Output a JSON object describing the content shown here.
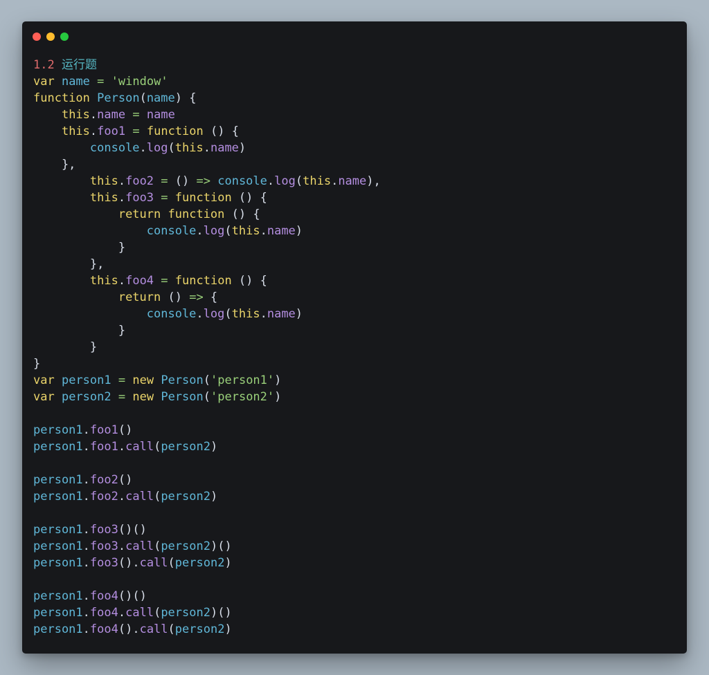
{
  "window": {
    "controls": [
      "close",
      "minimize",
      "maximize"
    ]
  },
  "colors": {
    "background": "#abb8c3",
    "panel": "#17181b",
    "keyword": "#ead46a",
    "identifier": "#60b7d8",
    "string": "#9ad07a",
    "property": "#b48ee0",
    "number": "#e06c6c",
    "punctuation": "#d8dee9"
  },
  "code": {
    "lines": [
      [
        [
          "num",
          "1.2"
        ],
        [
          "p",
          " "
        ],
        [
          "cjk",
          "运行题"
        ]
      ],
      [
        [
          "kw",
          "var"
        ],
        [
          "p",
          " "
        ],
        [
          "var",
          "name"
        ],
        [
          "p",
          " "
        ],
        [
          "op",
          "="
        ],
        [
          "p",
          " "
        ],
        [
          "str",
          "'window'"
        ]
      ],
      [
        [
          "kw",
          "function"
        ],
        [
          "p",
          " "
        ],
        [
          "fn",
          "Person"
        ],
        [
          "p",
          "("
        ],
        [
          "var",
          "name"
        ],
        [
          "p",
          ") {"
        ]
      ],
      [
        [
          "p",
          "    "
        ],
        [
          "kw",
          "this"
        ],
        [
          "p",
          "."
        ],
        [
          "prop",
          "name"
        ],
        [
          "p",
          " "
        ],
        [
          "op",
          "="
        ],
        [
          "p",
          " "
        ],
        [
          "prop",
          "name"
        ]
      ],
      [
        [
          "p",
          "    "
        ],
        [
          "kw",
          "this"
        ],
        [
          "p",
          "."
        ],
        [
          "prop",
          "foo1"
        ],
        [
          "p",
          " "
        ],
        [
          "op",
          "="
        ],
        [
          "p",
          " "
        ],
        [
          "kw",
          "function"
        ],
        [
          "p",
          " () {"
        ]
      ],
      [
        [
          "p",
          "        "
        ],
        [
          "var",
          "console"
        ],
        [
          "p",
          "."
        ],
        [
          "prop",
          "log"
        ],
        [
          "p",
          "("
        ],
        [
          "kw",
          "this"
        ],
        [
          "p",
          "."
        ],
        [
          "prop",
          "name"
        ],
        [
          "p",
          ")"
        ]
      ],
      [
        [
          "p",
          "    },"
        ]
      ],
      [
        [
          "p",
          "        "
        ],
        [
          "kw",
          "this"
        ],
        [
          "p",
          "."
        ],
        [
          "prop",
          "foo2"
        ],
        [
          "p",
          " "
        ],
        [
          "op",
          "="
        ],
        [
          "p",
          " () "
        ],
        [
          "op",
          "=>"
        ],
        [
          "p",
          " "
        ],
        [
          "var",
          "console"
        ],
        [
          "p",
          "."
        ],
        [
          "prop",
          "log"
        ],
        [
          "p",
          "("
        ],
        [
          "kw",
          "this"
        ],
        [
          "p",
          "."
        ],
        [
          "prop",
          "name"
        ],
        [
          "p",
          "),"
        ]
      ],
      [
        [
          "p",
          "        "
        ],
        [
          "kw",
          "this"
        ],
        [
          "p",
          "."
        ],
        [
          "prop",
          "foo3"
        ],
        [
          "p",
          " "
        ],
        [
          "op",
          "="
        ],
        [
          "p",
          " "
        ],
        [
          "kw",
          "function"
        ],
        [
          "p",
          " () {"
        ]
      ],
      [
        [
          "p",
          "            "
        ],
        [
          "kw",
          "return"
        ],
        [
          "p",
          " "
        ],
        [
          "kw",
          "function"
        ],
        [
          "p",
          " () {"
        ]
      ],
      [
        [
          "p",
          "                "
        ],
        [
          "var",
          "console"
        ],
        [
          "p",
          "."
        ],
        [
          "prop",
          "log"
        ],
        [
          "p",
          "("
        ],
        [
          "kw",
          "this"
        ],
        [
          "p",
          "."
        ],
        [
          "prop",
          "name"
        ],
        [
          "p",
          ")"
        ]
      ],
      [
        [
          "p",
          "            }"
        ]
      ],
      [
        [
          "p",
          "        },"
        ]
      ],
      [
        [
          "p",
          "        "
        ],
        [
          "kw",
          "this"
        ],
        [
          "p",
          "."
        ],
        [
          "prop",
          "foo4"
        ],
        [
          "p",
          " "
        ],
        [
          "op",
          "="
        ],
        [
          "p",
          " "
        ],
        [
          "kw",
          "function"
        ],
        [
          "p",
          " () {"
        ]
      ],
      [
        [
          "p",
          "            "
        ],
        [
          "kw",
          "return"
        ],
        [
          "p",
          " () "
        ],
        [
          "op",
          "=>"
        ],
        [
          "p",
          " {"
        ]
      ],
      [
        [
          "p",
          "                "
        ],
        [
          "var",
          "console"
        ],
        [
          "p",
          "."
        ],
        [
          "prop",
          "log"
        ],
        [
          "p",
          "("
        ],
        [
          "kw",
          "this"
        ],
        [
          "p",
          "."
        ],
        [
          "prop",
          "name"
        ],
        [
          "p",
          ")"
        ]
      ],
      [
        [
          "p",
          "            }"
        ]
      ],
      [
        [
          "p",
          "        }"
        ]
      ],
      [
        [
          "p",
          "}"
        ]
      ],
      [
        [
          "kw",
          "var"
        ],
        [
          "p",
          " "
        ],
        [
          "var",
          "person1"
        ],
        [
          "p",
          " "
        ],
        [
          "op",
          "="
        ],
        [
          "p",
          " "
        ],
        [
          "kw",
          "new"
        ],
        [
          "p",
          " "
        ],
        [
          "fn",
          "Person"
        ],
        [
          "p",
          "("
        ],
        [
          "str",
          "'person1'"
        ],
        [
          "p",
          ")"
        ]
      ],
      [
        [
          "kw",
          "var"
        ],
        [
          "p",
          " "
        ],
        [
          "var",
          "person2"
        ],
        [
          "p",
          " "
        ],
        [
          "op",
          "="
        ],
        [
          "p",
          " "
        ],
        [
          "kw",
          "new"
        ],
        [
          "p",
          " "
        ],
        [
          "fn",
          "Person"
        ],
        [
          "p",
          "("
        ],
        [
          "str",
          "'person2'"
        ],
        [
          "p",
          ")"
        ]
      ],
      [
        [
          "p",
          ""
        ]
      ],
      [
        [
          "var",
          "person1"
        ],
        [
          "p",
          "."
        ],
        [
          "prop",
          "foo1"
        ],
        [
          "p",
          "()"
        ]
      ],
      [
        [
          "var",
          "person1"
        ],
        [
          "p",
          "."
        ],
        [
          "prop",
          "foo1"
        ],
        [
          "p",
          "."
        ],
        [
          "prop",
          "call"
        ],
        [
          "p",
          "("
        ],
        [
          "var",
          "person2"
        ],
        [
          "p",
          ")"
        ]
      ],
      [
        [
          "p",
          ""
        ]
      ],
      [
        [
          "var",
          "person1"
        ],
        [
          "p",
          "."
        ],
        [
          "prop",
          "foo2"
        ],
        [
          "p",
          "()"
        ]
      ],
      [
        [
          "var",
          "person1"
        ],
        [
          "p",
          "."
        ],
        [
          "prop",
          "foo2"
        ],
        [
          "p",
          "."
        ],
        [
          "prop",
          "call"
        ],
        [
          "p",
          "("
        ],
        [
          "var",
          "person2"
        ],
        [
          "p",
          ")"
        ]
      ],
      [
        [
          "p",
          ""
        ]
      ],
      [
        [
          "var",
          "person1"
        ],
        [
          "p",
          "."
        ],
        [
          "prop",
          "foo3"
        ],
        [
          "p",
          "()()"
        ]
      ],
      [
        [
          "var",
          "person1"
        ],
        [
          "p",
          "."
        ],
        [
          "prop",
          "foo3"
        ],
        [
          "p",
          "."
        ],
        [
          "prop",
          "call"
        ],
        [
          "p",
          "("
        ],
        [
          "var",
          "person2"
        ],
        [
          "p",
          ")()"
        ]
      ],
      [
        [
          "var",
          "person1"
        ],
        [
          "p",
          "."
        ],
        [
          "prop",
          "foo3"
        ],
        [
          "p",
          "()."
        ],
        [
          "prop",
          "call"
        ],
        [
          "p",
          "("
        ],
        [
          "var",
          "person2"
        ],
        [
          "p",
          ")"
        ]
      ],
      [
        [
          "p",
          ""
        ]
      ],
      [
        [
          "var",
          "person1"
        ],
        [
          "p",
          "."
        ],
        [
          "prop",
          "foo4"
        ],
        [
          "p",
          "()()"
        ]
      ],
      [
        [
          "var",
          "person1"
        ],
        [
          "p",
          "."
        ],
        [
          "prop",
          "foo4"
        ],
        [
          "p",
          "."
        ],
        [
          "prop",
          "call"
        ],
        [
          "p",
          "("
        ],
        [
          "var",
          "person2"
        ],
        [
          "p",
          ")()"
        ]
      ],
      [
        [
          "var",
          "person1"
        ],
        [
          "p",
          "."
        ],
        [
          "prop",
          "foo4"
        ],
        [
          "p",
          "()."
        ],
        [
          "prop",
          "call"
        ],
        [
          "p",
          "("
        ],
        [
          "var",
          "person2"
        ],
        [
          "p",
          ")"
        ]
      ]
    ]
  }
}
